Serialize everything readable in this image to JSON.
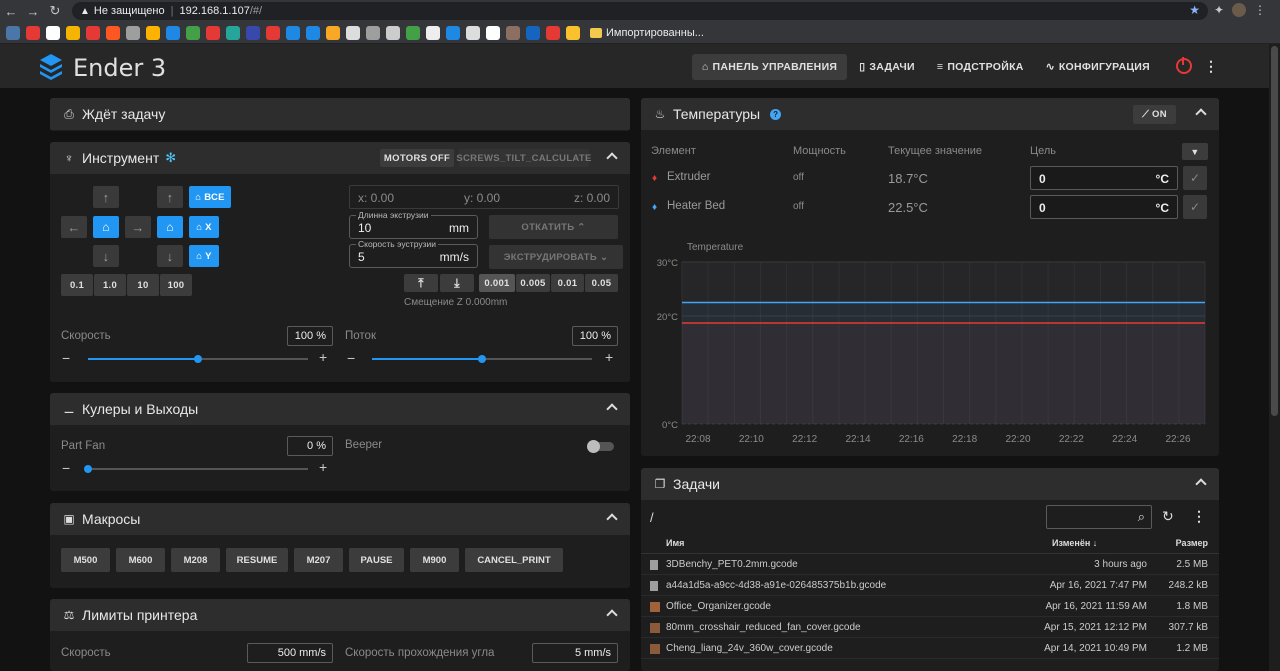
{
  "browser": {
    "insecure_label": "Не защищено",
    "url_host": "192.168.1.107",
    "url_path": "/#/",
    "bookmark_folder": "Импортированны..."
  },
  "app": {
    "brand": "Ender 3",
    "nav": [
      {
        "label": "ПАНЕЛЬ УПРАВЛЕНИЯ",
        "icon": "home-icon",
        "active": true
      },
      {
        "label": "ЗАДАЧИ",
        "icon": "file-icon",
        "active": false
      },
      {
        "label": "ПОДСТРОЙКА",
        "icon": "tune-icon",
        "active": false
      },
      {
        "label": "КОНФИГУРАЦИЯ",
        "icon": "config-icon",
        "active": false
      }
    ]
  },
  "status": {
    "title": "Ждёт задачу"
  },
  "tool": {
    "title": "Инструмент",
    "motors_off": "MOTORS OFF",
    "screws_tilt": "SCREWS_TILT_CALCULATE",
    "home_all": "ВСЕ",
    "home_x": "X",
    "home_y": "Y",
    "steps": [
      "0.1",
      "1.0",
      "10",
      "100"
    ],
    "pos_x": "x: 0.00",
    "pos_y": "y: 0.00",
    "pos_z": "z: 0.00",
    "extrude_len_label": "Длинна экструзии",
    "extrude_len_value": "10",
    "extrude_len_unit": "mm",
    "extrude_speed_label": "Скорость эуструзии",
    "extrude_speed_value": "5",
    "extrude_speed_unit": "mm/s",
    "retract": "ОТКАТИТЬ",
    "extrude": "ЭКСТРУДИРОВАТЬ",
    "z_steps": [
      "0.001",
      "0.005",
      "0.01",
      "0.05"
    ],
    "z_offset": "Смещение Z 0.000mm",
    "speed_label": "Скорость",
    "speed_value": "100 %",
    "speed_level": 0.5,
    "flow_label": "Поток",
    "flow_value": "100 %",
    "flow_level": 0.5
  },
  "fans": {
    "title": "Кулеры и Выходы",
    "part_fan_label": "Part Fan",
    "part_fan_value": "0 %",
    "part_fan_level": 0.0,
    "beeper_label": "Beeper"
  },
  "macros": {
    "title": "Макросы",
    "items": [
      "M500",
      "M600",
      "M208",
      "RESUME",
      "M207",
      "PAUSE",
      "M900",
      "CANCEL_PRINT"
    ]
  },
  "limits": {
    "title": "Лимиты принтера",
    "speed_label": "Скорость",
    "speed_value": "500 mm/s",
    "corner_label": "Скорость прохождения угла",
    "corner_value": "5 mm/s"
  },
  "temps": {
    "title": "Температуры",
    "toggle_label": "ON",
    "cols": [
      "Элемент",
      "Мощность",
      "Текущее значение",
      "Цель"
    ],
    "rows": [
      {
        "name": "Extruder",
        "power": "off",
        "current": "18.7°C",
        "target": "0",
        "unit": "°C",
        "color": "#e53935"
      },
      {
        "name": "Heater Bed",
        "power": "off",
        "current": "22.5°C",
        "target": "0",
        "unit": "°C",
        "color": "#42a5f5"
      }
    ]
  },
  "chart_data": {
    "type": "line",
    "title": "Temperature",
    "x": [
      "22:08",
      "22:10",
      "22:12",
      "22:14",
      "22:16",
      "22:18",
      "22:20",
      "22:22",
      "22:24",
      "22:26"
    ],
    "ylim": [
      0,
      30
    ],
    "yticks": [
      "30°C",
      "20°C",
      "0°C"
    ],
    "series": [
      {
        "values": [
          22.5,
          22.5,
          22.5,
          22.5,
          22.5,
          22.5,
          22.5,
          22.5,
          22.5,
          22.5
        ],
        "color": "#42a5f5"
      },
      {
        "values": [
          18.7,
          18.7,
          18.7,
          18.7,
          18.7,
          18.7,
          18.7,
          18.7,
          18.7,
          18.7
        ],
        "color": "#e53935"
      }
    ]
  },
  "jobs": {
    "title": "Задачи",
    "path": "/",
    "col_name": "Имя",
    "col_modified": "Изменён",
    "col_size": "Размер",
    "files": [
      {
        "name": "3DBenchy_PET0.2mm.gcode",
        "modified": "3 hours ago",
        "size": "2.5 MB"
      },
      {
        "name": "a44a1d5a-a9cc-4d38-a91e-026485375b1b.gcode",
        "modified": "Apr 16, 2021 7:47 PM",
        "size": "248.2 kB"
      },
      {
        "name": "Office_Organizer.gcode",
        "modified": "Apr 16, 2021 11:59 AM",
        "size": "1.8 MB"
      },
      {
        "name": "80mm_crosshair_reduced_fan_cover.gcode",
        "modified": "Apr 15, 2021 12:12 PM",
        "size": "307.7 kB"
      },
      {
        "name": "Cheng_liang_24v_360w_cover.gcode",
        "modified": "Apr 14, 2021 10:49 PM",
        "size": "1.2 MB"
      }
    ]
  }
}
